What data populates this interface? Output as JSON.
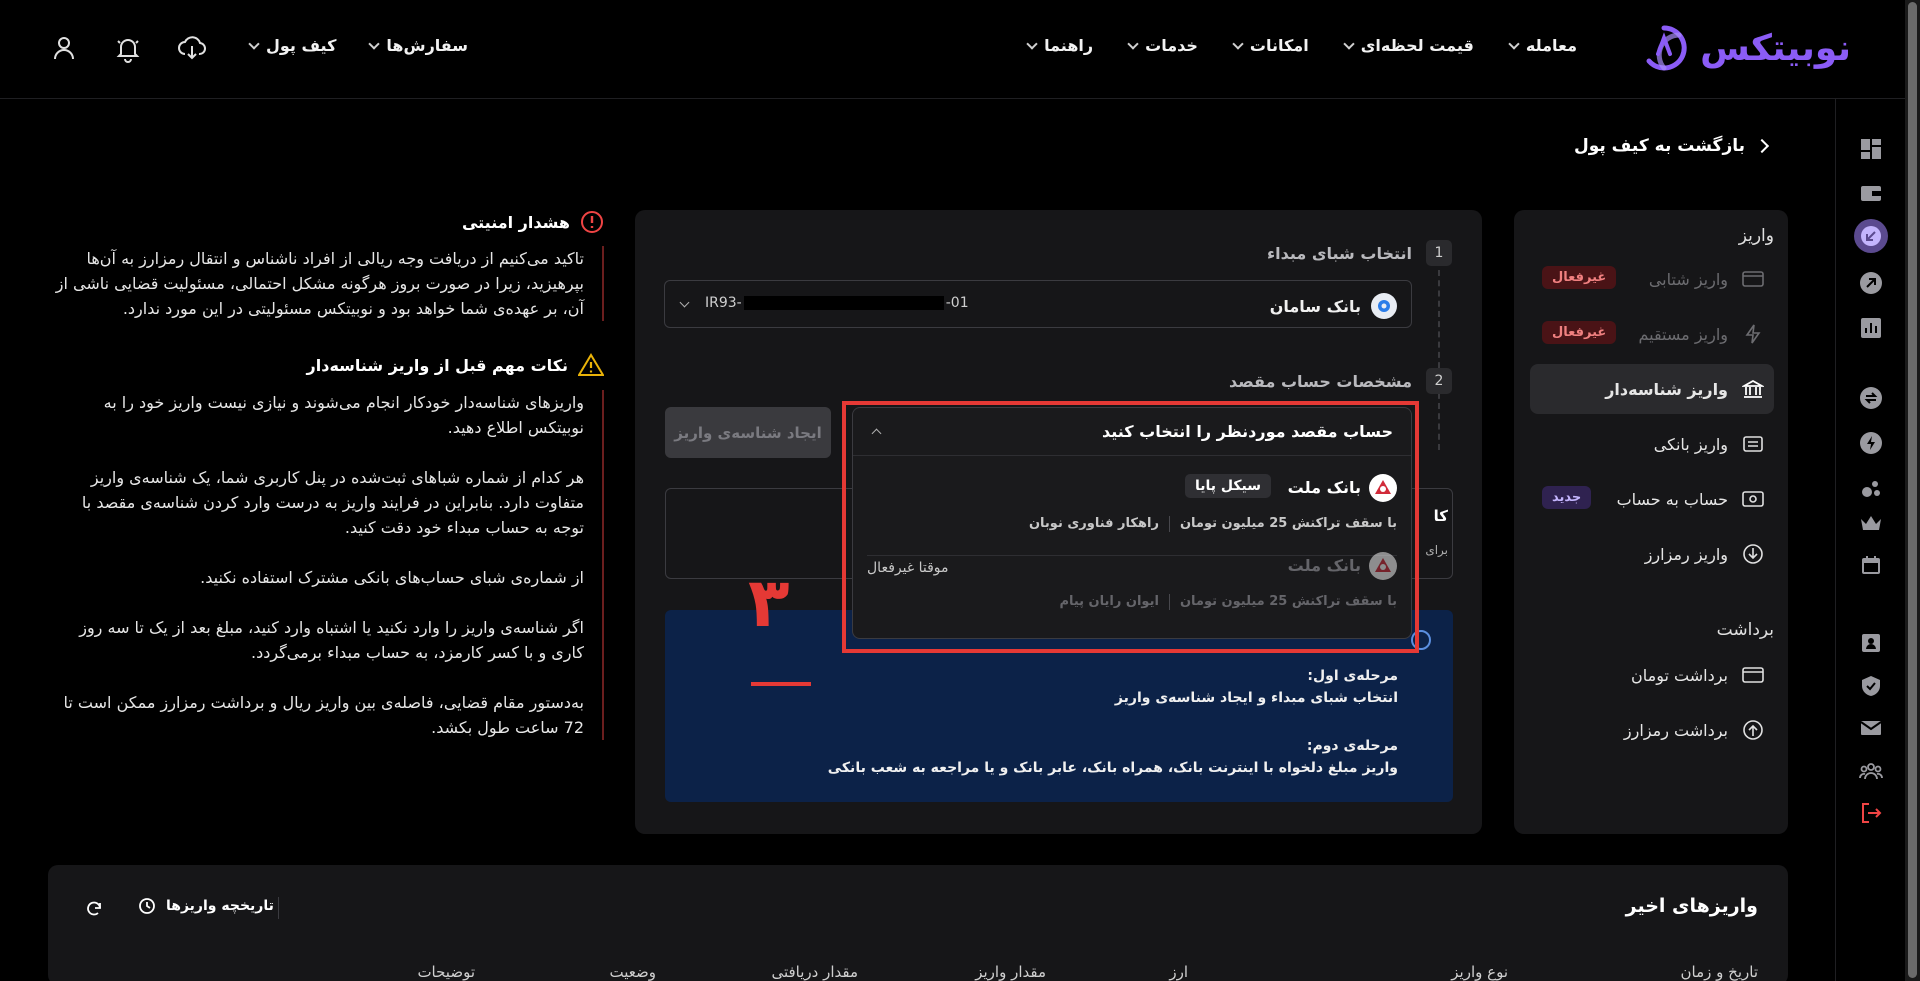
{
  "brand": {
    "name": "نوبیتکس",
    "accent": "#8b5cf6"
  },
  "nav": {
    "items": [
      {
        "label": "معامله"
      },
      {
        "label": "قیمت لحظه‌ای"
      },
      {
        "label": "امکانات"
      },
      {
        "label": "خدمات"
      },
      {
        "label": "راهنما"
      }
    ],
    "orders": "سفارش‌ها",
    "wallet": "کیف پول",
    "icons": [
      "user-icon",
      "bell-icon",
      "cloud-download-icon"
    ]
  },
  "back_link": "بازگشت به کیف پول",
  "side": {
    "deposit_title": "واریز",
    "withdraw_title": "برداشت",
    "items": [
      {
        "label": "واریز شتابی",
        "badge": "غیرفعال",
        "disabled": true
      },
      {
        "label": "واریز مستقیم",
        "badge": "غیرفعال",
        "disabled": true
      },
      {
        "label": "واریز شناسه‌دار",
        "active": true
      },
      {
        "label": "واریز بانکی"
      },
      {
        "label": "حساب به حساب",
        "badge": "جدید"
      },
      {
        "label": "واریز رمزارز"
      }
    ],
    "withdraw_items": [
      {
        "label": "برداشت تومان"
      },
      {
        "label": "برداشت رمزارز"
      }
    ]
  },
  "form": {
    "step1_num": "1",
    "step1_title": "انتخاب شبای مبداء",
    "source_bank": "بانک سامان",
    "iban_prefix": "IR93-",
    "iban_suffix": "-01",
    "step2_num": "2",
    "step2_title": "مشخصات حساب مقصد",
    "create_button": "ایجاد شناسه‌ی واریز",
    "card_title_partial": "کا",
    "card_sub_partial": "برای"
  },
  "dropdown": {
    "placeholder": "حساب مقصد موردنظر را انتخاب کنید",
    "options": [
      {
        "bank": "بانک ملت",
        "tag": "سیکل پایا",
        "limit": "با سقف تراکنش 25 میلیون تومان",
        "company": "راهکار فناوری نوبان",
        "status": ""
      },
      {
        "bank": "بانک ملت",
        "tag": "",
        "limit": "با سقف تراکنش 25 میلیون تومان",
        "company": "ایوان رایان پیام",
        "status": "موقتا غیرفعال"
      }
    ]
  },
  "annotation": {
    "number": "۳",
    "color": "#e53935"
  },
  "info": {
    "stage1_title": "مرحله‌ی اول:",
    "stage1_text": "انتخاب شبای مبداء و ایجاد شناسه‌ی واریز",
    "stage2_title": "مرحله‌ی دوم:",
    "stage2_text": "واریز مبلغ دلخواه با اینترنت بانک، همراه بانک، عابر بانک و یا مراجعه به شعب بانکی"
  },
  "warnings": {
    "security_title": "هشدار امنیتی",
    "security_text": "تاکید می‌کنیم از دریافت وجه ریالی از افراد ناشناس و انتقال رمزارز به آن‌ها بپرهیزید، زیرا در صورت بروز هرگونه مشکل احتمالی، مسئولیت قضایی ناشی از آن، بر عهده‌ی شما خواهد بود و نوبیتکس مسئولیتی در این مورد ندارد.",
    "notes_title": "نکات مهم قبل از واریز شناسه‌دار",
    "notes": [
      "واریزهای شناسه‌دار خودکار انجام می‌شوند و نیازی نیست واریز خود را به نوبیتکس اطلاع دهید.",
      "هر کدام از شماره شباهای ثبت‌شده در پنل کاربری شما، یک شناسه‌ی واریز متفاوت دارد. بنابراین در فرایند واریز به درست وارد کردن شناسه‌ی مقصد با توجه به حساب مبداء خود دقت کنید.",
      "از شماره‌ی شبای حساب‌های بانکی مشترک استفاده نکنید.",
      "اگر شناسه‌ی واریز را وارد نکنید یا اشتباه وارد کنید، مبلغ بعد از یک تا سه روز کاری و با کسر کارمزد، به حساب مبداء برمی‌گردد.",
      "به‌دستور مقام قضایی، فاصله‌ی بین واریز ریال و برداشت رمزارز ممکن است تا 72 ساعت طول بکشد."
    ]
  },
  "recent": {
    "title": "واریزهای اخیر",
    "history": "تاریخچه واریزها",
    "columns": [
      "تاریخ و زمان",
      "نوع واریز",
      "ارز",
      "مقدار واریز",
      "مقدار دریافتی",
      "وضعیت",
      "توضیحات"
    ]
  }
}
